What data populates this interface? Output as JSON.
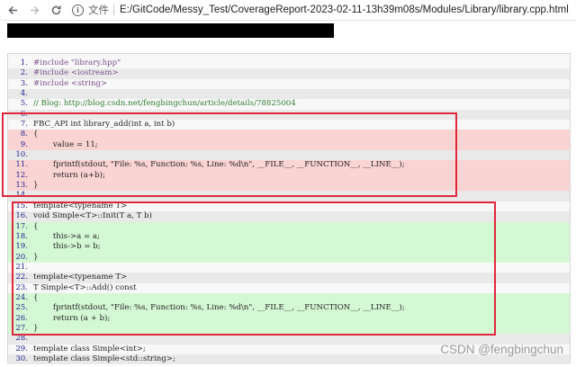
{
  "browser": {
    "back_icon": "arrow-left-icon",
    "forward_icon": "arrow-right-icon",
    "reload_icon": "reload-icon",
    "info_icon": "info-icon",
    "scheme_label": "文件",
    "url": "E:/GitCode/Messy_Test/CoverageReport-2023-02-11-13h39m08s/Modules/Library/library.cpp.html"
  },
  "colors": {
    "covered_line": "#d4f8d4",
    "uncovered_line": "#fad3d3",
    "annotation_box": "#e0283c"
  },
  "code_lines": [
    {
      "n": "1.",
      "text": "#include \"library.hpp\"",
      "kind": "pp",
      "cov": "none"
    },
    {
      "n": "2.",
      "text": "#include <iostream>",
      "kind": "pp",
      "cov": "none"
    },
    {
      "n": "3.",
      "text": "#include <string>",
      "kind": "pp",
      "cov": "none"
    },
    {
      "n": "4.",
      "text": "",
      "kind": "plain",
      "cov": "none"
    },
    {
      "n": "5.",
      "text": "// Blog: http://blog.csdn.net/fengbingchun/article/details/78825004",
      "kind": "comment",
      "cov": "none"
    },
    {
      "n": "6.",
      "text": "",
      "kind": "plain",
      "cov": "none"
    },
    {
      "n": "7.",
      "text": "FBC_API int library_add(int a, int b)",
      "kind": "plain",
      "cov": "none"
    },
    {
      "n": "8.",
      "text": "{",
      "kind": "plain",
      "cov": "miss"
    },
    {
      "n": "9.",
      "text": "        value = 11;",
      "kind": "plain",
      "cov": "miss"
    },
    {
      "n": "10.",
      "text": "",
      "kind": "plain",
      "cov": "none"
    },
    {
      "n": "11.",
      "text": "        fprintf(stdout, \"File: %s, Function: %s, Line: %d\\n\", __FILE__, __FUNCTION__, __LINE__);",
      "kind": "plain",
      "cov": "miss"
    },
    {
      "n": "12.",
      "text": "        return (a+b);",
      "kind": "plain",
      "cov": "miss"
    },
    {
      "n": "13.",
      "text": "}",
      "kind": "plain",
      "cov": "miss"
    },
    {
      "n": "14.",
      "text": "",
      "kind": "plain",
      "cov": "none"
    },
    {
      "n": "15.",
      "text": "template<typename T>",
      "kind": "plain",
      "cov": "none"
    },
    {
      "n": "16.",
      "text": "void Simple<T>::Init(T a, T b)",
      "kind": "plain",
      "cov": "none"
    },
    {
      "n": "17.",
      "text": "{",
      "kind": "plain",
      "cov": "hit"
    },
    {
      "n": "18.",
      "text": "        this->a = a;",
      "kind": "plain",
      "cov": "hit"
    },
    {
      "n": "19.",
      "text": "        this->b = b;",
      "kind": "plain",
      "cov": "hit"
    },
    {
      "n": "20.",
      "text": "}",
      "kind": "plain",
      "cov": "hit"
    },
    {
      "n": "21.",
      "text": "",
      "kind": "plain",
      "cov": "none"
    },
    {
      "n": "22.",
      "text": "template<typename T>",
      "kind": "plain",
      "cov": "none"
    },
    {
      "n": "23.",
      "text": "T Simple<T>::Add() const",
      "kind": "plain",
      "cov": "none"
    },
    {
      "n": "24.",
      "text": "{",
      "kind": "plain",
      "cov": "hit"
    },
    {
      "n": "25.",
      "text": "        fprintf(stdout, \"File: %s, Function: %s, Line: %d\\n\", __FILE__, __FUNCTION__, __LINE__);",
      "kind": "plain",
      "cov": "hit"
    },
    {
      "n": "26.",
      "text": "        return (a + b);",
      "kind": "plain",
      "cov": "hit"
    },
    {
      "n": "27.",
      "text": "}",
      "kind": "plain",
      "cov": "hit"
    },
    {
      "n": "28.",
      "text": "",
      "kind": "plain",
      "cov": "none"
    },
    {
      "n": "29.",
      "text": "template class Simple<int>;",
      "kind": "plain",
      "cov": "none"
    },
    {
      "n": "30.",
      "text": "template class Simple<std::string>;",
      "kind": "plain",
      "cov": "none"
    }
  ],
  "watermark": "CSDN @fengbingchun"
}
